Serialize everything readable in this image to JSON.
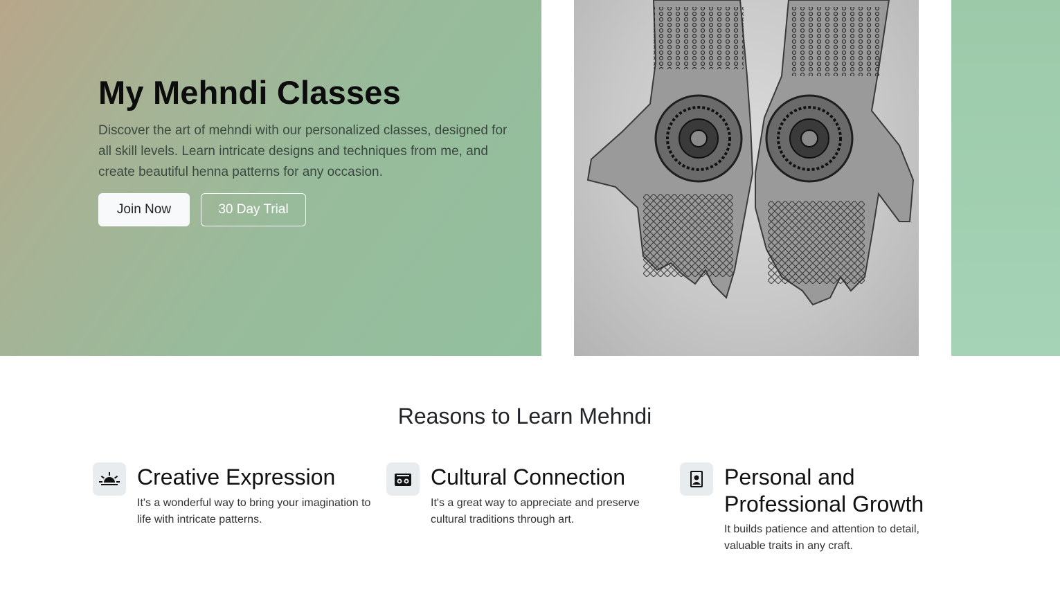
{
  "hero": {
    "title": "My Mehndi Classes",
    "description": "Discover the art of mehndi with our personalized classes, designed for all skill levels. Learn intricate designs and techniques from me, and create beautiful henna patterns for any occasion.",
    "join_label": "Join Now",
    "trial_label": "30 Day Trial",
    "image_alt": "Hands decorated with mehndi henna patterns"
  },
  "reasons": {
    "title": "Reasons to Learn Mehndi",
    "items": [
      {
        "title": "Creative Expression",
        "text": "It's a wonderful way to bring your imagination to life with intricate patterns.",
        "icon": "sunrise-icon"
      },
      {
        "title": "Cultural Connection",
        "text": "It's a great way to appreciate and preserve cultural traditions through art.",
        "icon": "radio-icon"
      },
      {
        "title": "Personal and Professional Growth",
        "text": "It builds patience and attention to detail, valuable traits in any craft.",
        "icon": "file-person-icon"
      }
    ]
  },
  "colors": {
    "hero_gradient_start": "#b8a68a",
    "hero_gradient_end": "#92c09f",
    "icon_bg": "#e9ecef",
    "button_light": "#f8f9fa"
  }
}
